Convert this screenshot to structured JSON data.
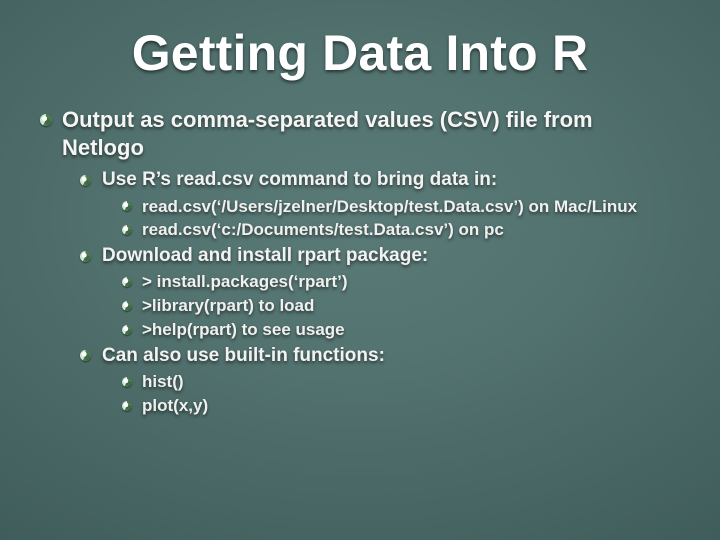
{
  "title": "Getting Data Into R",
  "bullets": {
    "l1_0": "Output as comma-separated values (CSV) file from Netlogo",
    "l2_0": "Use R’s read.csv command to bring data in:",
    "l3_0": "read.csv(‘/Users/jzelner/Desktop/test.Data.csv’) on Mac/Linux",
    "l3_1": "read.csv(‘c:/Documents/test.Data.csv’) on pc",
    "l2_1": "Download and install rpart package:",
    "l3_2": "> install.packages(‘rpart’)",
    "l3_3": ">library(rpart) to load",
    "l3_4": ">help(rpart) to see usage",
    "l2_2": "Can also use built-in functions:",
    "l3_5": "hist()",
    "l3_6": "plot(x,y)"
  }
}
